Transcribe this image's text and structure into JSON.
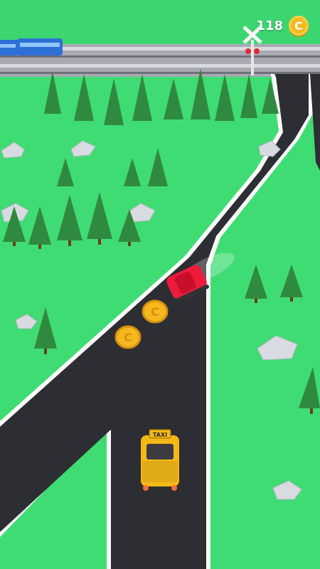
{
  "hud": {
    "coin_count": "118",
    "coin_symbol": "C"
  },
  "taxi": {
    "sign_text": "TAXI"
  },
  "colors": {
    "grass": "#3fdc73",
    "road": "#2d2e33",
    "road_edge": "#ffffff",
    "taxi": "#f5b817",
    "red_car": "#ee1c3c",
    "coin": "#f6b81e",
    "train": "#2d6fd6",
    "tree": "#2f8a3f"
  },
  "icons": {
    "coin": "coin-icon",
    "rail_crossing": "railroad-crossing-icon"
  }
}
